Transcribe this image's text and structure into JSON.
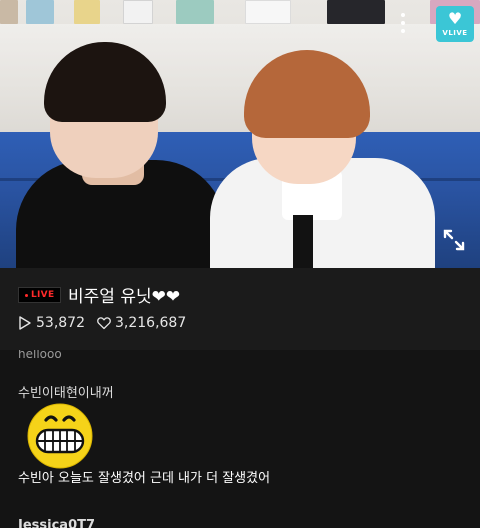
{
  "video": {
    "menu_icon": "more-vertical-icon",
    "brand_badge": {
      "icon": "vlive-logo-icon",
      "text": "VLIVE",
      "color": "#3bc6d6"
    },
    "expand_icon": "fullscreen-expand-icon"
  },
  "broadcast": {
    "live_label": "LIVE",
    "title": "비주얼 유닛❤❤",
    "plays": "53,872",
    "likes": "3,216,687",
    "play_icon": "play-outline-icon",
    "heart_icon": "heart-outline-icon",
    "accent_color": "#ff2a2a"
  },
  "chat": {
    "previous_message": "hellooo",
    "message": {
      "username": "수빈이태현이내꺼",
      "sticker": "grinning-face-sticker",
      "text": "수빈아 오늘도 잘생겼어 근데 내가 더 잘생겼어"
    },
    "next_username": "Jessica0T7"
  }
}
